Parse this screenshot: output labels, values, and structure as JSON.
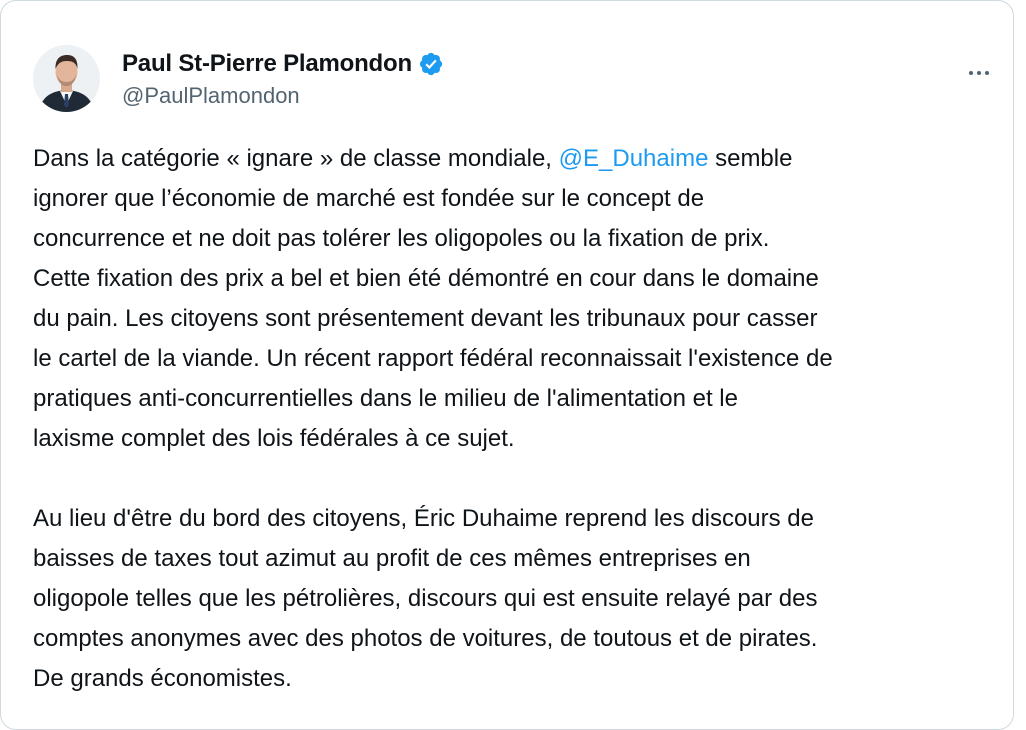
{
  "tweet": {
    "author": {
      "display_name": "Paul St-Pierre Plamondon",
      "handle": "@PaulPlamondon",
      "verified": true,
      "verified_color": "#1d9bf0"
    },
    "more_icon": "more-horizontal-icon",
    "paragraph1": {
      "line1_before": "Dans la catégorie « ignare » de classe mondiale, ",
      "line1_mention": "@E_Duhaime",
      "line1_after": " semble",
      "line2": "ignorer que l’économie de marché est fondée sur le concept de",
      "line3": "concurrence et ne doit pas tolérer les oligopoles ou la fixation de prix.",
      "line4": "Cette fixation des prix a bel et bien été démontré en cour dans le domaine",
      "line5": "du pain. Les citoyens sont présentement devant les tribunaux pour casser",
      "line6": "le cartel de la viande. Un récent rapport fédéral reconnaissait l'existence de",
      "line7": "pratiques anti-concurrentielles dans le milieu de l'alimentation et le",
      "line8": "laxisme complet des lois fédérales à ce sujet."
    },
    "paragraph2": {
      "line1": "Au lieu d'être du bord des citoyens, Éric Duhaime reprend les discours de",
      "line2": "baisses de taxes tout azimut au profit de ces mêmes entreprises en",
      "line3": "oligopole telles que les pétrolières, discours qui est ensuite relayé par des",
      "line4": "comptes anonymes avec des photos de voitures, de toutous et de pirates.",
      "line5": "De grands économistes."
    },
    "colors": {
      "text": "#0f1419",
      "secondary": "#536471",
      "link": "#1d9bf0",
      "border": "#cfd9de"
    }
  }
}
